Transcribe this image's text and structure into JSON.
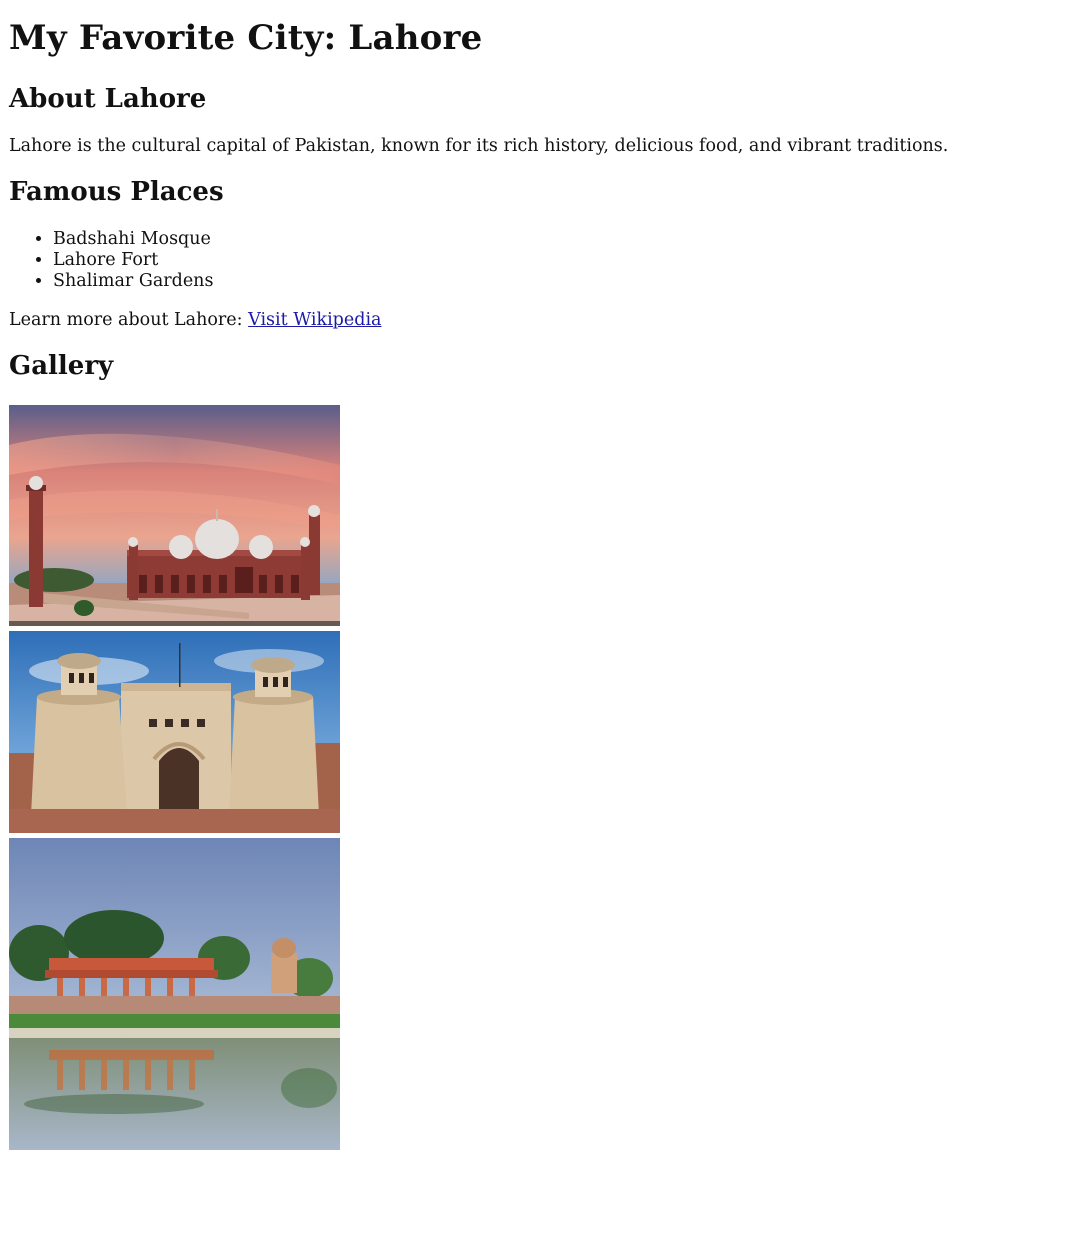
{
  "page": {
    "title": "My Favorite City: Lahore"
  },
  "about": {
    "heading": "About Lahore",
    "text": "Lahore is the cultural capital of Pakistan, known for its rich history, delicious food, and vibrant traditions."
  },
  "places": {
    "heading": "Famous Places",
    "items": [
      "Badshahi Mosque",
      "Lahore Fort",
      "Shalimar Gardens"
    ]
  },
  "learn_more": {
    "prefix": "Learn more about Lahore: ",
    "link_text": "Visit Wikipedia"
  },
  "gallery": {
    "heading": "Gallery",
    "images": [
      {
        "name": "badshahi-mosque-photo"
      },
      {
        "name": "lahore-fort-photo"
      },
      {
        "name": "shalimar-gardens-photo"
      }
    ]
  },
  "colors": {
    "link": "#1a1aa6",
    "text": "#111111",
    "background": "#ffffff"
  }
}
